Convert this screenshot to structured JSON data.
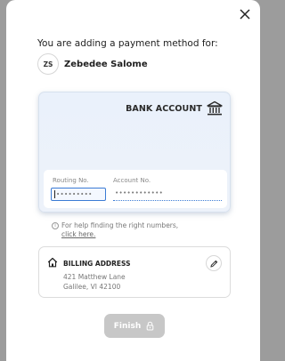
{
  "modal": {
    "heading": "You are adding a payment method for:",
    "user": {
      "initials": "ZS",
      "name": "Zebedee Salome"
    }
  },
  "bank_card": {
    "title": "BANK ACCOUNT",
    "routing_label": "Routing No.",
    "routing_value": "•••••••••",
    "account_label": "Account No.",
    "account_value": "••••••••••••"
  },
  "help": {
    "text": "For help finding the right numbers,",
    "link": "click here."
  },
  "billing": {
    "title": "BILLING ADDRESS",
    "line1": "421 Matthew Lane",
    "line2": "Galilee, VI 42100"
  },
  "finish_label": "Finish",
  "colors": {
    "focus": "#3b7bd4",
    "disabled_button": "#c7c7c7"
  },
  "icons": [
    "close-icon",
    "bank-icon",
    "info-icon",
    "house-icon",
    "pencil-icon",
    "lock-icon"
  ]
}
